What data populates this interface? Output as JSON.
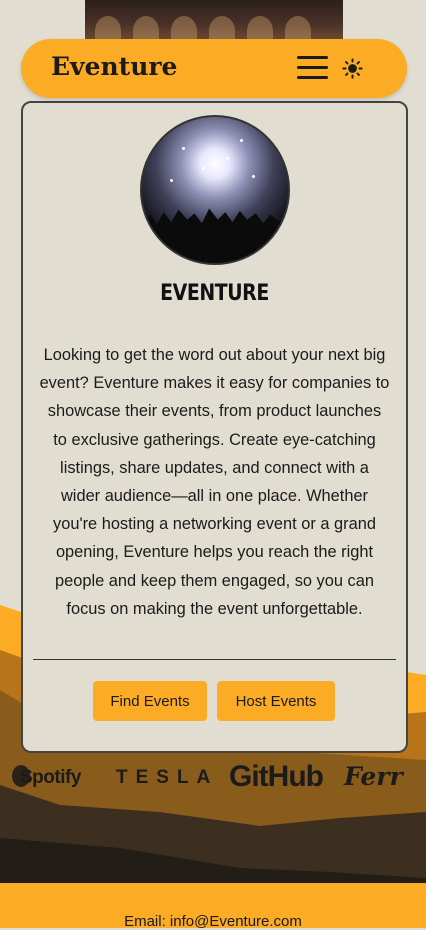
{
  "header": {
    "brand": "Eventure",
    "menu_icon": "hamburger-menu-icon",
    "theme_icon": "sun-icon"
  },
  "hero": {
    "image": "concert-crowd-photo",
    "logo_text": "EVENTURE",
    "description": "Looking to get the word out about your next big event? Eventure makes it easy for companies to showcase their events, from product launches to exclusive gatherings. Create eye-catching listings, share updates, and connect with a wider audience—all in one place. Whether you're hosting a networking event or a grand opening, Eventure helps you reach the right people and keep them engaged, so you can focus on making the event unforgettable.",
    "buttons": {
      "find": "Find Events",
      "host": "Host Events"
    }
  },
  "partners": [
    "Spotify",
    "TESLA",
    "GitHub",
    "Ferr"
  ],
  "footer": {
    "email": "Email: info@Eventure.com"
  },
  "colors": {
    "accent": "#fcab25",
    "background": "#e1ddd1",
    "text": "#1b1b1b",
    "hill_mid": "#b87418",
    "hill_dark": "#3c2f20"
  }
}
